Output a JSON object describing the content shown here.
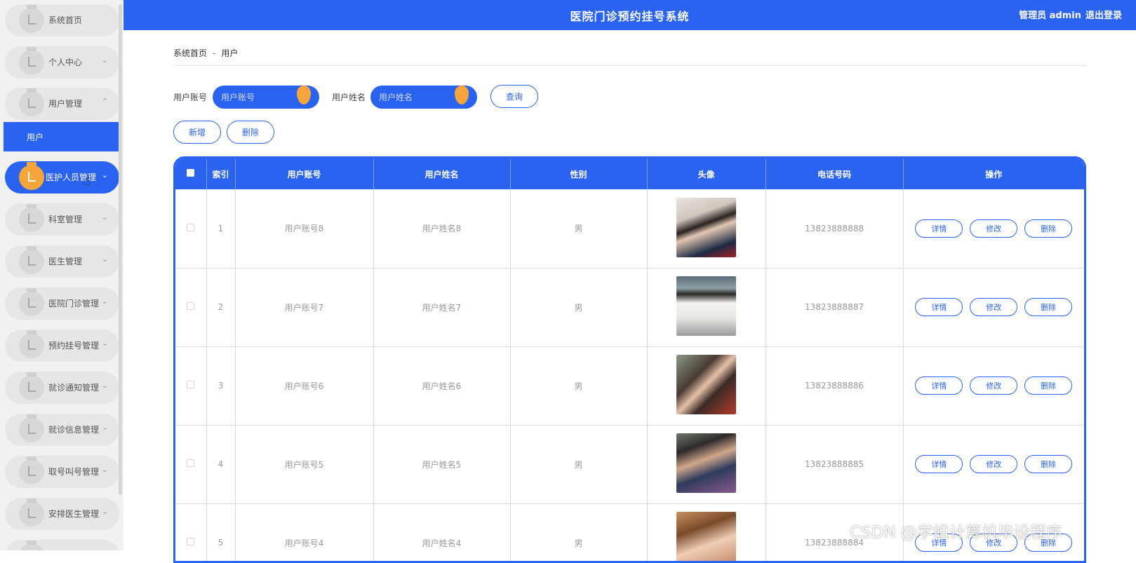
{
  "header": {
    "title": "医院门诊预约挂号系统",
    "user": "管理员 admin",
    "logout": "退出登录"
  },
  "sidebar": {
    "items": [
      {
        "label": "系统首页",
        "arrow": ""
      },
      {
        "label": "个人中心",
        "arrow": "⌄"
      },
      {
        "label": "用户管理",
        "arrow": "⌃"
      },
      {
        "label": "医护人员管理",
        "arrow": "⌄"
      },
      {
        "label": "科室管理",
        "arrow": "⌄"
      },
      {
        "label": "医生管理",
        "arrow": "⌄"
      },
      {
        "label": "医院门诊管理",
        "arrow": "⌄"
      },
      {
        "label": "预约挂号管理",
        "arrow": "⌄"
      },
      {
        "label": "就诊通知管理",
        "arrow": "⌄"
      },
      {
        "label": "就诊信息管理",
        "arrow": "⌄"
      },
      {
        "label": "取号叫号管理",
        "arrow": "⌄"
      },
      {
        "label": "安排医生管理",
        "arrow": "⌄"
      }
    ],
    "sub_item": "用户"
  },
  "breadcrumb": {
    "home": "系统首页",
    "separator": "-",
    "current": "用户"
  },
  "search": {
    "account_label": "用户账号",
    "account_placeholder": "用户账号",
    "name_label": "用户姓名",
    "name_placeholder": "用户姓名",
    "query_button": "查询"
  },
  "actions": {
    "add": "新增",
    "delete": "删除"
  },
  "table": {
    "columns": [
      "索引",
      "用户账号",
      "用户姓名",
      "性别",
      "头像",
      "电话号码",
      "操作"
    ],
    "row_buttons": {
      "detail": "详情",
      "edit": "修改",
      "delete": "删除"
    },
    "rows": [
      {
        "index": "1",
        "account": "用户账号8",
        "name": "用户姓名8",
        "gender": "男",
        "phone": "13823888888"
      },
      {
        "index": "2",
        "account": "用户账号7",
        "name": "用户姓名7",
        "gender": "男",
        "phone": "13823888887"
      },
      {
        "index": "3",
        "account": "用户账号6",
        "name": "用户姓名6",
        "gender": "男",
        "phone": "13823888886"
      },
      {
        "index": "4",
        "account": "用户账号5",
        "name": "用户姓名5",
        "gender": "男",
        "phone": "13823888885"
      },
      {
        "index": "5",
        "account": "用户账号4",
        "name": "用户姓名4",
        "gender": "男",
        "phone": "13823888884"
      }
    ]
  },
  "colors": {
    "primary": "#2a63f0",
    "accent": "#f5a53a",
    "sidebar_bg": "#f1f1ef"
  },
  "watermark": "CSDN @学姐计算机毕设程序"
}
